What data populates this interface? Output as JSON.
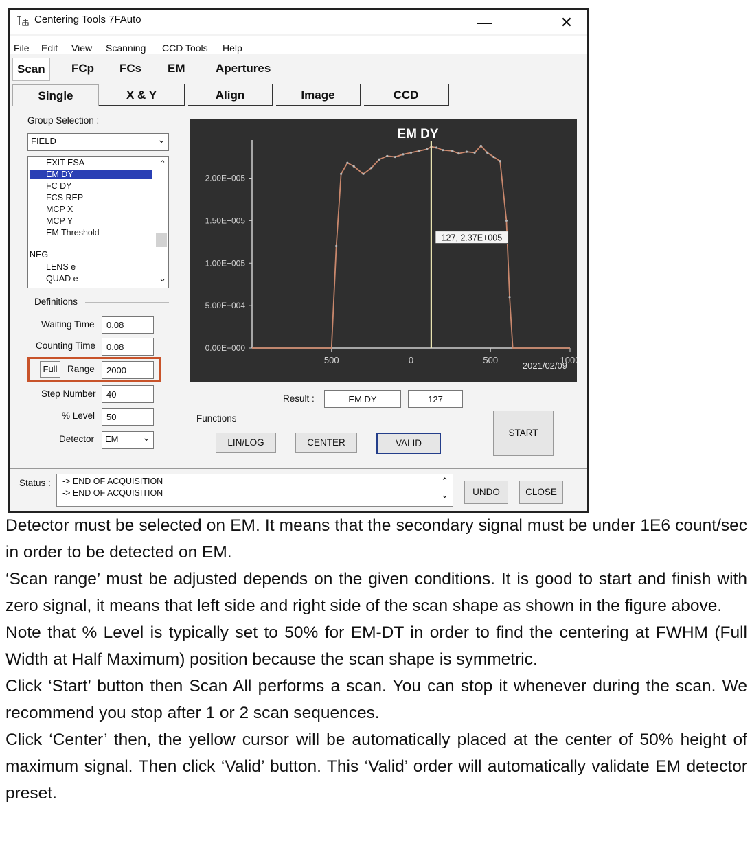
{
  "window": {
    "title": "Centering Tools 7FAuto",
    "minimize": "—",
    "close": "✕"
  },
  "menu": [
    "File",
    "Edit",
    "View",
    "Scanning",
    "CCD Tools",
    "Help"
  ],
  "tabs_top": [
    "Scan All",
    "FCp",
    "FCs",
    "EM",
    "Apertures"
  ],
  "tabs_sub": [
    "Single",
    "X & Y",
    "Align",
    "Image",
    "CCD"
  ],
  "group_selection": {
    "label": "Group Selection :",
    "value": "FIELD",
    "items": [
      "EXIT ESA",
      "EM DY",
      "FC DY",
      "FCS REP",
      "MCP X",
      "MCP Y",
      "EM Threshold"
    ],
    "selected": "EM DY",
    "neg_header": "NEG",
    "neg_items": [
      "LENS e",
      "QUAD e"
    ]
  },
  "definitions": {
    "label": "Definitions",
    "waiting_time_label": "Waiting Time",
    "waiting_time": "0.08",
    "counting_time_label": "Counting Time",
    "counting_time": "0.08",
    "full_label": "Full",
    "range_label": "Range",
    "range": "2000",
    "step_number_label": "Step Number",
    "step_number": "40",
    "level_label": "% Level",
    "level": "50",
    "detector_label": "Detector",
    "detector": "EM"
  },
  "chart_data": {
    "type": "line",
    "title": "EM DY",
    "y_ticks": [
      "2.00E+005",
      "1.50E+005",
      "1.00E+005",
      "5.00E+004",
      "0.00E+000"
    ],
    "x_ticks": [
      "500",
      "0",
      "500",
      "1000"
    ],
    "date": "2021/02/09",
    "cursor_label": "127, 2.37E+005",
    "cursor_x": 127,
    "ylim": [
      0,
      240000
    ],
    "xlim": [
      -1000,
      1000
    ],
    "x": [
      -1000,
      -560,
      -500,
      -470,
      -440,
      -400,
      -360,
      -300,
      -250,
      -200,
      -150,
      -100,
      -50,
      0,
      50,
      100,
      127,
      160,
      200,
      260,
      300,
      350,
      400,
      440,
      480,
      520,
      560,
      600,
      620,
      640,
      680,
      1000
    ],
    "y": [
      0,
      0,
      0,
      120000,
      205000,
      218000,
      214000,
      205000,
      212000,
      222000,
      226000,
      225000,
      228000,
      230000,
      232000,
      234000,
      237000,
      236000,
      233000,
      232000,
      229000,
      231000,
      230000,
      238000,
      230000,
      225000,
      220000,
      150000,
      60000,
      0,
      0,
      0
    ],
    "grid": false
  },
  "result": {
    "label": "Result :",
    "name": "EM DY",
    "value": "127"
  },
  "functions": {
    "label": "Functions",
    "lin_log": "LIN/LOG",
    "center": "CENTER",
    "valid": "VALID"
  },
  "start": "START",
  "status": {
    "label": "Status :",
    "lines": [
      "-> END OF ACQUISITION",
      "-> END OF ACQUISITION"
    ]
  },
  "undo": "UNDO",
  "close": "CLOSE",
  "caption": [
    "Detector must be selected on EM. It means that the secondary signal must be under 1E6 count/sec in order to be detected on EM.",
    "‘Scan range’ must be adjusted depends on the given conditions. It is good to start and finish with zero signal, it means that left side and right side of the scan shape as shown in the figure above.",
    "Note that % Level is typically set to 50% for EM-DT in order to find the centering at FWHM (Full Width at Half Maximum) position because the scan shape is symmetric.",
    "Click ‘Start’ button then Scan All performs a scan. You can stop it whenever during the scan. We recommend you stop after 1 or 2 scan sequences.",
    "Click ‘Center’ then, the yellow cursor will be automatically placed at the center of 50% height of maximum signal. Then click ‘Valid’ button. This ‘Valid’ order will automatically validate EM detector preset."
  ]
}
